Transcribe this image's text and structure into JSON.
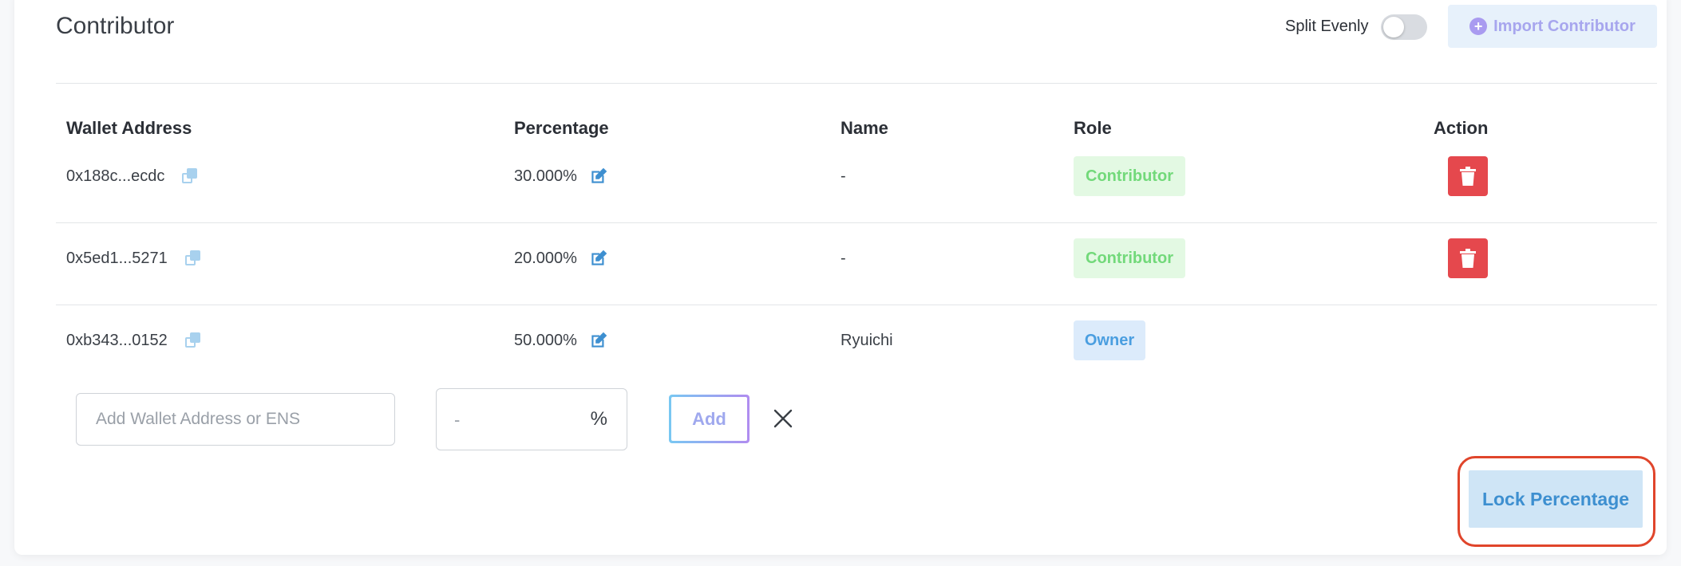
{
  "section": {
    "title": "Contributor",
    "split_evenly_label": "Split Evenly",
    "split_evenly_on": false,
    "import_button_label": "Import Contributor"
  },
  "table": {
    "headers": [
      "Wallet Address",
      "Percentage",
      "Name",
      "Role",
      "Action"
    ],
    "rows": [
      {
        "wallet": "0x188c...ecdc",
        "percentage": "30.000%",
        "name": "-",
        "role": "Contributor",
        "deletable": true
      },
      {
        "wallet": "0x5ed1...5271",
        "percentage": "20.000%",
        "name": "-",
        "role": "Contributor",
        "deletable": true
      },
      {
        "wallet": "0xb343...0152",
        "percentage": "50.000%",
        "name": "Ryuichi",
        "role": "Owner",
        "deletable": false
      }
    ]
  },
  "add_form": {
    "wallet_placeholder": "Add Wallet Address or ENS",
    "percentage_placeholder": "-",
    "percent_sign": "%",
    "add_button_label": "Add"
  },
  "lock_button_label": "Lock Percentage",
  "colors": {
    "delete_red": "#e5484d",
    "contributor_green": "#72d97a",
    "owner_blue": "#4a9ee0",
    "highlight_ring": "#e0452b"
  }
}
